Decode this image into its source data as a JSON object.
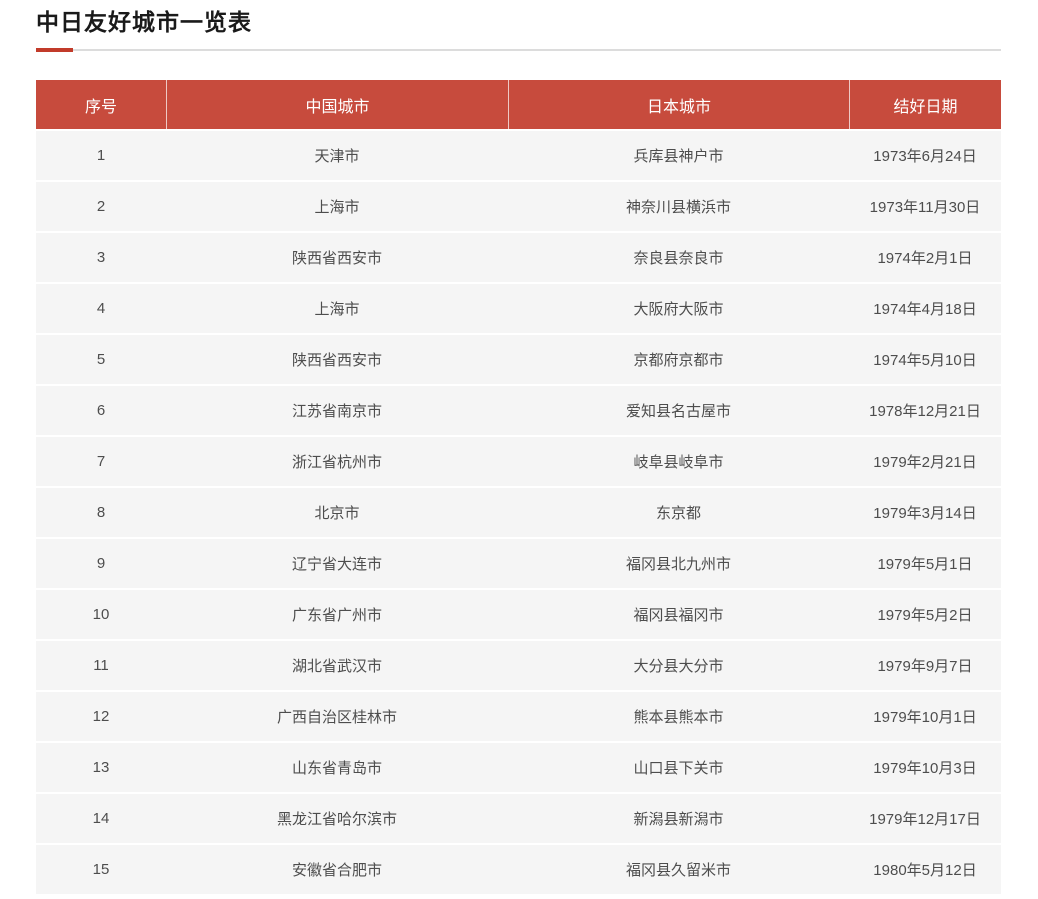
{
  "page": {
    "title": "中日友好城市一览表"
  },
  "colors": {
    "header_bg": "#c74b3d",
    "accent_red": "#c23b2a",
    "divider_gray": "#dcdcdc",
    "row_bg": "#f5f5f5",
    "header_text": "#ffffff",
    "cell_text": "#4d4d4d"
  },
  "table": {
    "columns": [
      {
        "key": "no",
        "label": "序号"
      },
      {
        "key": "cn",
        "label": "中国城市"
      },
      {
        "key": "jp",
        "label": "日本城市"
      },
      {
        "key": "date",
        "label": "结好日期"
      }
    ],
    "rows": [
      {
        "no": "1",
        "cn": "天津市",
        "jp": "兵库县神户市",
        "date": "1973年6月24日"
      },
      {
        "no": "2",
        "cn": "上海市",
        "jp": "神奈川县横浜市",
        "date": "1973年11月30日"
      },
      {
        "no": "3",
        "cn": "陕西省西安市",
        "jp": "奈良县奈良市",
        "date": "1974年2月1日"
      },
      {
        "no": "4",
        "cn": "上海市",
        "jp": "大阪府大阪市",
        "date": "1974年4月18日"
      },
      {
        "no": "5",
        "cn": "陕西省西安市",
        "jp": "京都府京都市",
        "date": "1974年5月10日"
      },
      {
        "no": "6",
        "cn": "江苏省南京市",
        "jp": "爱知县名古屋市",
        "date": "1978年12月21日"
      },
      {
        "no": "7",
        "cn": "浙江省杭州市",
        "jp": "岐阜县岐阜市",
        "date": "1979年2月21日"
      },
      {
        "no": "8",
        "cn": "北京市",
        "jp": "东京都",
        "date": "1979年3月14日"
      },
      {
        "no": "9",
        "cn": "辽宁省大连市",
        "jp": "福冈县北九州市",
        "date": "1979年5月1日"
      },
      {
        "no": "10",
        "cn": "广东省广州市",
        "jp": "福冈县福冈市",
        "date": "1979年5月2日"
      },
      {
        "no": "11",
        "cn": "湖北省武汉市",
        "jp": "大分县大分市",
        "date": "1979年9月7日"
      },
      {
        "no": "12",
        "cn": "广西自治区桂林市",
        "jp": "熊本县熊本市",
        "date": "1979年10月1日"
      },
      {
        "no": "13",
        "cn": "山东省青岛市",
        "jp": "山口县下关市",
        "date": "1979年10月3日"
      },
      {
        "no": "14",
        "cn": "黑龙江省哈尔滨市",
        "jp": "新潟县新潟市",
        "date": "1979年12月17日"
      },
      {
        "no": "15",
        "cn": "安徽省合肥市",
        "jp": "福冈县久留米市",
        "date": "1980年5月12日"
      }
    ]
  }
}
